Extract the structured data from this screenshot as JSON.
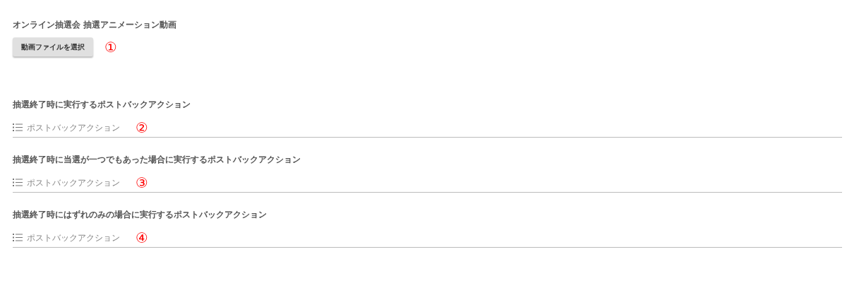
{
  "title": "オンライン抽選会 抽選アニメーション動画",
  "file_button": {
    "label": "動画ファイルを選択",
    "annotation": "①"
  },
  "actions": [
    {
      "label": "抽選終了時に実行するポストバックアクション",
      "placeholder": "ポストバックアクション",
      "annotation": "②"
    },
    {
      "label": "抽選終了時に当選が一つでもあった場合に実行するポストバックアクション",
      "placeholder": "ポストバックアクション",
      "annotation": "③"
    },
    {
      "label": "抽選終了時にはずれのみの場合に実行するポストバックアクション",
      "placeholder": "ポストバックアクション",
      "annotation": "④"
    }
  ]
}
